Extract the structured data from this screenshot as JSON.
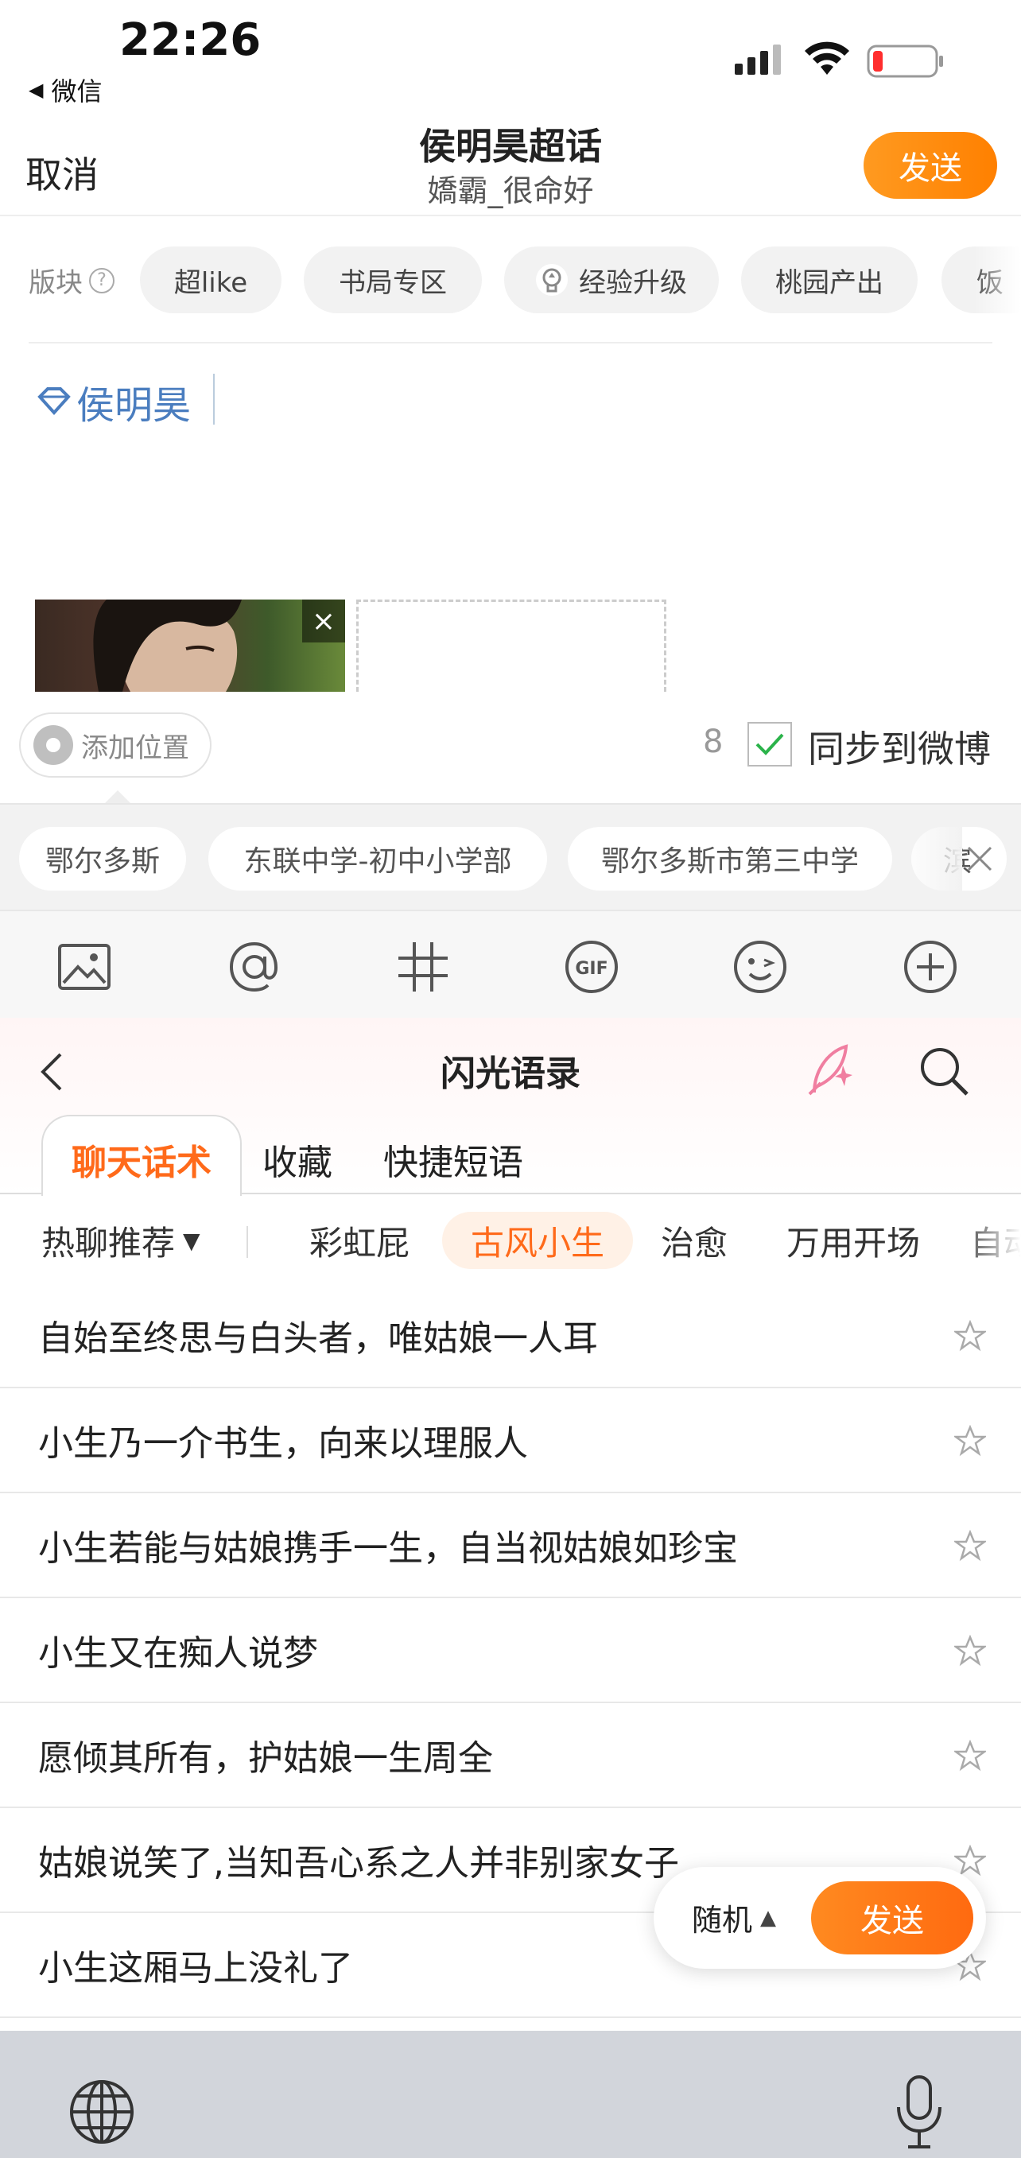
{
  "status_bar": {
    "time": "22:26",
    "back_app": "微信"
  },
  "header": {
    "cancel_label": "取消",
    "title": "侯明昊超话",
    "subtitle": "嬌霸_很命好",
    "send_label": "发送"
  },
  "sections": {
    "label": "版块",
    "chips": [
      {
        "label": "超like"
      },
      {
        "label": "书局专区"
      },
      {
        "label": "经验升级"
      },
      {
        "label": "桃园产出"
      },
      {
        "label": "饭"
      }
    ]
  },
  "composer": {
    "topic_tag": "侯明昊"
  },
  "location": {
    "add_label": "添加位置",
    "count": "8",
    "sync_label": "同步到微博",
    "sync_checked": true,
    "suggestions": [
      "鄂尔多斯",
      "东联中学-初中小学部",
      "鄂尔多斯市第三中学",
      "滨"
    ]
  },
  "toolbar": {
    "icons": [
      "image-icon",
      "at-icon",
      "hashtag-icon",
      "gif-icon",
      "emoji-icon",
      "plus-icon"
    ]
  },
  "panel": {
    "title": "闪光语录",
    "tabs": [
      {
        "label": "聊天话术",
        "active": true
      },
      {
        "label": "收藏",
        "active": false
      },
      {
        "label": "快捷短语",
        "active": false
      }
    ],
    "dropdown_label": "热聊推荐",
    "categories": [
      {
        "label": "彩虹屁",
        "active": false
      },
      {
        "label": "古风小生",
        "active": true
      },
      {
        "label": "治愈",
        "active": false
      },
      {
        "label": "万用开场",
        "active": false
      },
      {
        "label": "自动",
        "active": false
      }
    ],
    "phrases": [
      "自始至终思与白头者，唯姑娘一人耳",
      "小生乃一介书生，向来以理服人",
      "小生若能与姑娘携手一生，自当视姑娘如珍宝",
      "小生又在痴人说梦",
      "愿倾其所有，护姑娘一生周全",
      "姑娘说笑了,当知吾心系之人并非别家女子",
      "小生这厢马上没礼了"
    ],
    "random_label": "随机",
    "send_label": "发送"
  },
  "colors": {
    "accent": "#ff6a1a",
    "send_gradient_start": "#ff9a20",
    "topic_blue": "#4a7dbf"
  }
}
